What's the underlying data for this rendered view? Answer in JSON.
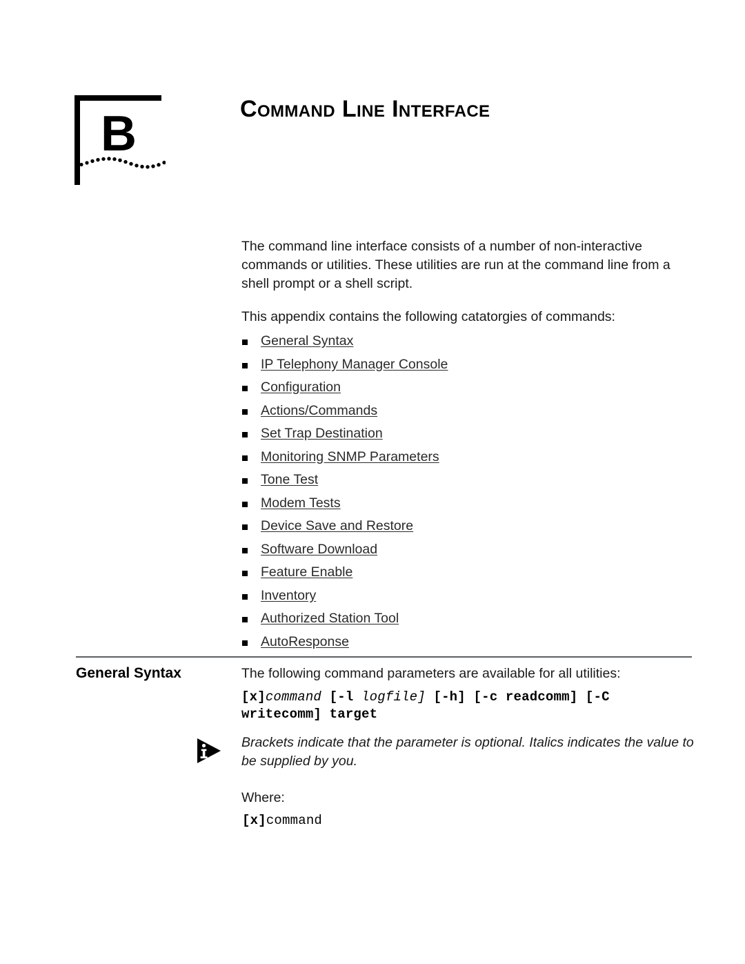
{
  "chapter": {
    "letter": "B",
    "title": "Command Line Interface",
    "marker_icon": "chapter-flag-dotted-wave"
  },
  "intro": {
    "paragraph": "The command line interface consists of a number of non-interactive commands or utilities. These utilities are run at the command line from a shell prompt or a shell script.",
    "appendix_lead": "This appendix contains the following catatorgies of commands:"
  },
  "links": [
    {
      "label": "General Syntax"
    },
    {
      "label": "IP Telephony Manager Console"
    },
    {
      "label": "Configuration"
    },
    {
      "label": "Actions/Commands"
    },
    {
      "label": "Set Trap Destination"
    },
    {
      "label": "Monitoring SNMP Parameters"
    },
    {
      "label": "Tone Test"
    },
    {
      "label": "Modem Tests"
    },
    {
      "label": "Device Save and Restore"
    },
    {
      "label": "Software Download"
    },
    {
      "label": "Feature Enable"
    },
    {
      "label": "Inventory"
    },
    {
      "label": "Authorized Station Tool"
    },
    {
      "label": "AutoResponse"
    }
  ],
  "general_syntax": {
    "heading": "General Syntax",
    "intro": "The following command parameters are available for all utilities:",
    "syntax_parts": {
      "p1_bold": "[x]",
      "p2_italic": "command",
      "p3_bold": " [-l ",
      "p4_italic": "logfile]",
      "p5_bold": " [-h] [-c readcomm] [-C writecomm] target"
    },
    "syntax_plain": "[x]command [-l logfile] [-h] [-c readcomm] [-C writecomm] target"
  },
  "note": {
    "icon": "info-triangle-icon",
    "text": "Brackets indicate that the parameter is optional. Italics indicates the value to be supplied by you."
  },
  "where": {
    "label": "Where:",
    "term_bold": "[x]",
    "term_plain": "command"
  },
  "colors": {
    "rule": "#5b5f63",
    "text": "#1a1a1a",
    "link": "#2a2a2a"
  }
}
